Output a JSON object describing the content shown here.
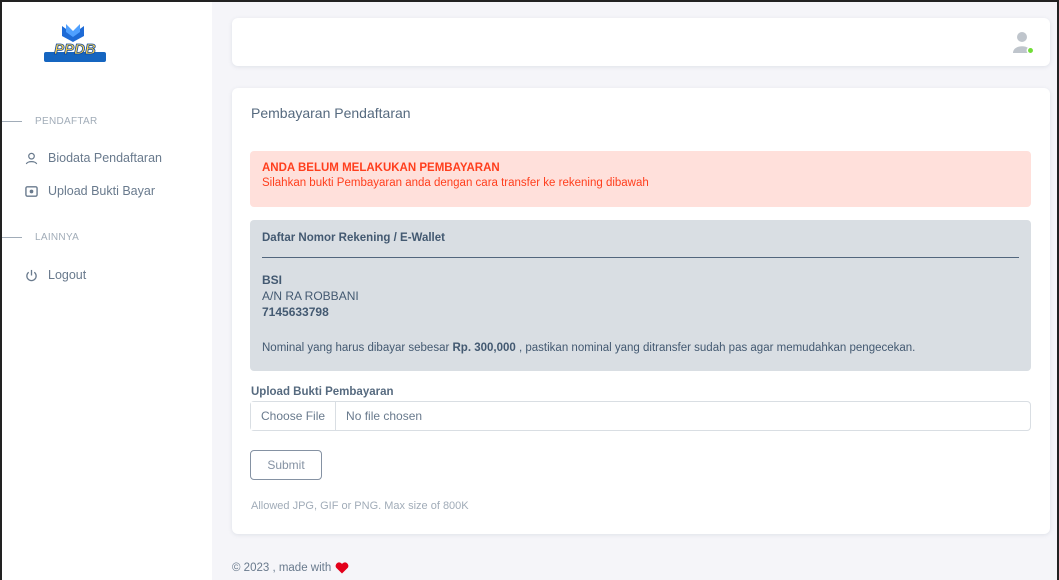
{
  "sidebar": {
    "logo_text": "PPDB",
    "sections": [
      {
        "header": "PENDAFTAR"
      },
      {
        "header": "LAINNYA"
      }
    ],
    "items": [
      {
        "label": "Biodata Pendaftaran",
        "icon": "user-icon"
      },
      {
        "label": "Upload Bukti Bayar",
        "icon": "image-icon"
      },
      {
        "label": "Logout",
        "icon": "power-icon"
      }
    ]
  },
  "navbar": {
    "avatar_icon": "user-avatar-icon",
    "status_color": "#71dd37"
  },
  "card": {
    "title": "Pembayaran Pendaftaran",
    "alert": {
      "title": "ANDA BELUM MELAKUKAN PEMBAYARAN",
      "text": "Silahkan bukti Pembayaran anda dengan cara transfer ke rekening dibawah",
      "color": "#ff3e1d"
    },
    "accounts": {
      "title": "Daftar Nomor Rekening / E-Wallet",
      "bank": "BSI",
      "account_name": "A/N RA ROBBANI",
      "account_number": "7145633798",
      "nominal_prefix": "Nominal yang harus dibayar sebesar",
      "nominal_amount": "Rp. 300,000",
      "nominal_suffix": ", pastikan nominal yang ditransfer sudah pas agar memudahkan pengecekan."
    },
    "upload": {
      "label": "Upload Bukti Pembayaran",
      "choose_file": "Choose File",
      "no_file": "No file chosen"
    },
    "submit_label": "Submit",
    "hint": "Allowed JPG, GIF or PNG. Max size of 800K"
  },
  "footer": {
    "text": "© 2023 , made with",
    "heart_color": "#e3001b"
  }
}
